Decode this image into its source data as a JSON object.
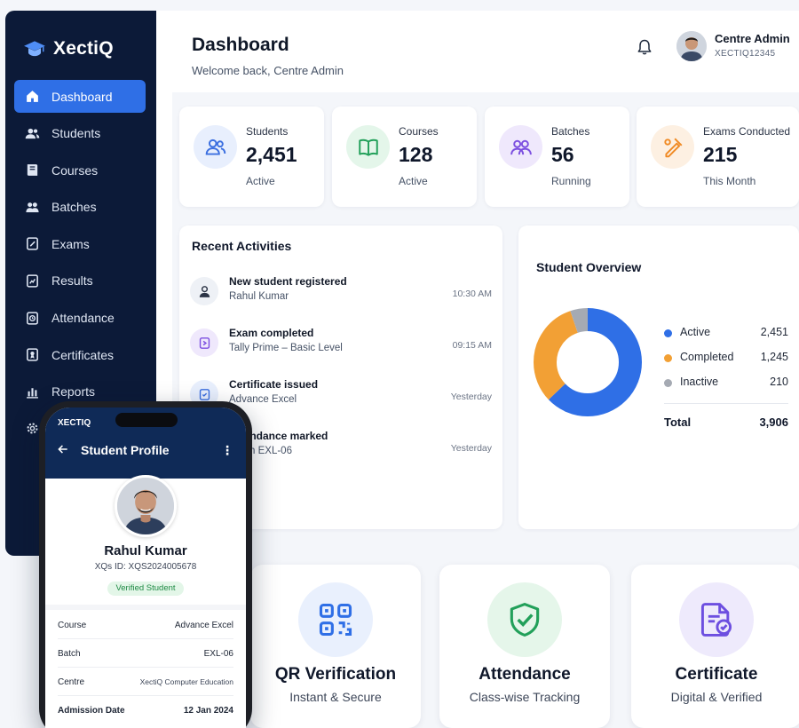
{
  "app": {
    "brand": "XectiQ"
  },
  "sidebar": {
    "items": [
      {
        "label": "Dashboard",
        "icon": "home-icon",
        "active": true
      },
      {
        "label": "Students",
        "icon": "users-icon"
      },
      {
        "label": "Courses",
        "icon": "book-icon"
      },
      {
        "label": "Batches",
        "icon": "group-icon"
      },
      {
        "label": "Exams",
        "icon": "exam-icon"
      },
      {
        "label": "Results",
        "icon": "results-icon"
      },
      {
        "label": "Attendance",
        "icon": "attendance-icon"
      },
      {
        "label": "Certificates",
        "icon": "certificate-icon"
      },
      {
        "label": "Reports",
        "icon": "reports-icon"
      }
    ]
  },
  "header": {
    "title": "Dashboard",
    "subtitle": "Welcome back, Centre Admin",
    "user_name": "Centre Admin",
    "user_id": "XECTIQ12345"
  },
  "stats": [
    {
      "label": "Students",
      "value": "2,451",
      "sub": "Active",
      "icon": "users-icon",
      "color": "#3b6fe0",
      "bg": "#e8effd"
    },
    {
      "label": "Courses",
      "value": "128",
      "sub": "Active",
      "icon": "book-icon",
      "color": "#22a05a",
      "bg": "#e4f6ea"
    },
    {
      "label": "Batches",
      "value": "56",
      "sub": "Running",
      "icon": "group-icon",
      "color": "#7c4fe0",
      "bg": "#efe8fc"
    },
    {
      "label": "Exams Conducted",
      "value": "215",
      "sub": "This Month",
      "icon": "exam-icon",
      "color": "#f08a24",
      "bg": "#fdf0e2"
    }
  ],
  "activities": {
    "title": "Recent Activities",
    "items": [
      {
        "title": "New student registered",
        "detail": "Rahul Kumar",
        "time": "10:30 AM",
        "icon": "user-icon"
      },
      {
        "title": "Exam completed",
        "detail": "Tally Prime – Basic Level",
        "time": "09:15 AM",
        "icon": "exam-icon"
      },
      {
        "title": "Certificate issued",
        "detail": "Advance Excel",
        "time": "Yesterday",
        "icon": "certificate-icon"
      },
      {
        "title": "Attendance marked",
        "detail": "Batch EXL-06",
        "time": "Yesterday",
        "icon": "attendance-icon"
      }
    ]
  },
  "overview": {
    "title": "Student Overview",
    "total_label": "Total",
    "total_value": "3,906"
  },
  "chart_data": {
    "type": "pie",
    "title": "Student Overview",
    "categories": [
      "Active",
      "Completed",
      "Inactive"
    ],
    "values": [
      2451,
      1245,
      210
    ],
    "colors": [
      "#2f6fe6",
      "#f2a035",
      "#a5aab3"
    ],
    "total": 3906,
    "legend": "right"
  },
  "features": [
    {
      "title": "QR Verification",
      "sub": "Instant & Secure",
      "icon": "qr-code-icon",
      "color": "#2f6fe6",
      "bg": "#e9f0fd"
    },
    {
      "title": "Attendance",
      "sub": "Class-wise Tracking",
      "icon": "shield-check-icon",
      "color": "#22a05a",
      "bg": "#e5f6ea"
    },
    {
      "title": "Certificate",
      "sub": "Digital & Verified",
      "icon": "certificate-icon",
      "color": "#6d4fe0",
      "bg": "#eeeafc"
    }
  ],
  "phone": {
    "brand": "XECTIQ",
    "title": "Student Profile",
    "more": "⋮",
    "name": "Rahul Kumar",
    "student_id": "XQs ID: XQS2024005678",
    "badge": "Verified Student",
    "details": [
      {
        "key": "Course",
        "value": "Advance Excel"
      },
      {
        "key": "Batch",
        "value": "EXL-06"
      },
      {
        "key": "Centre",
        "value": "XectiQ Computer Education"
      },
      {
        "key": "Admission Date",
        "value": "12 Jan 2024"
      }
    ]
  }
}
